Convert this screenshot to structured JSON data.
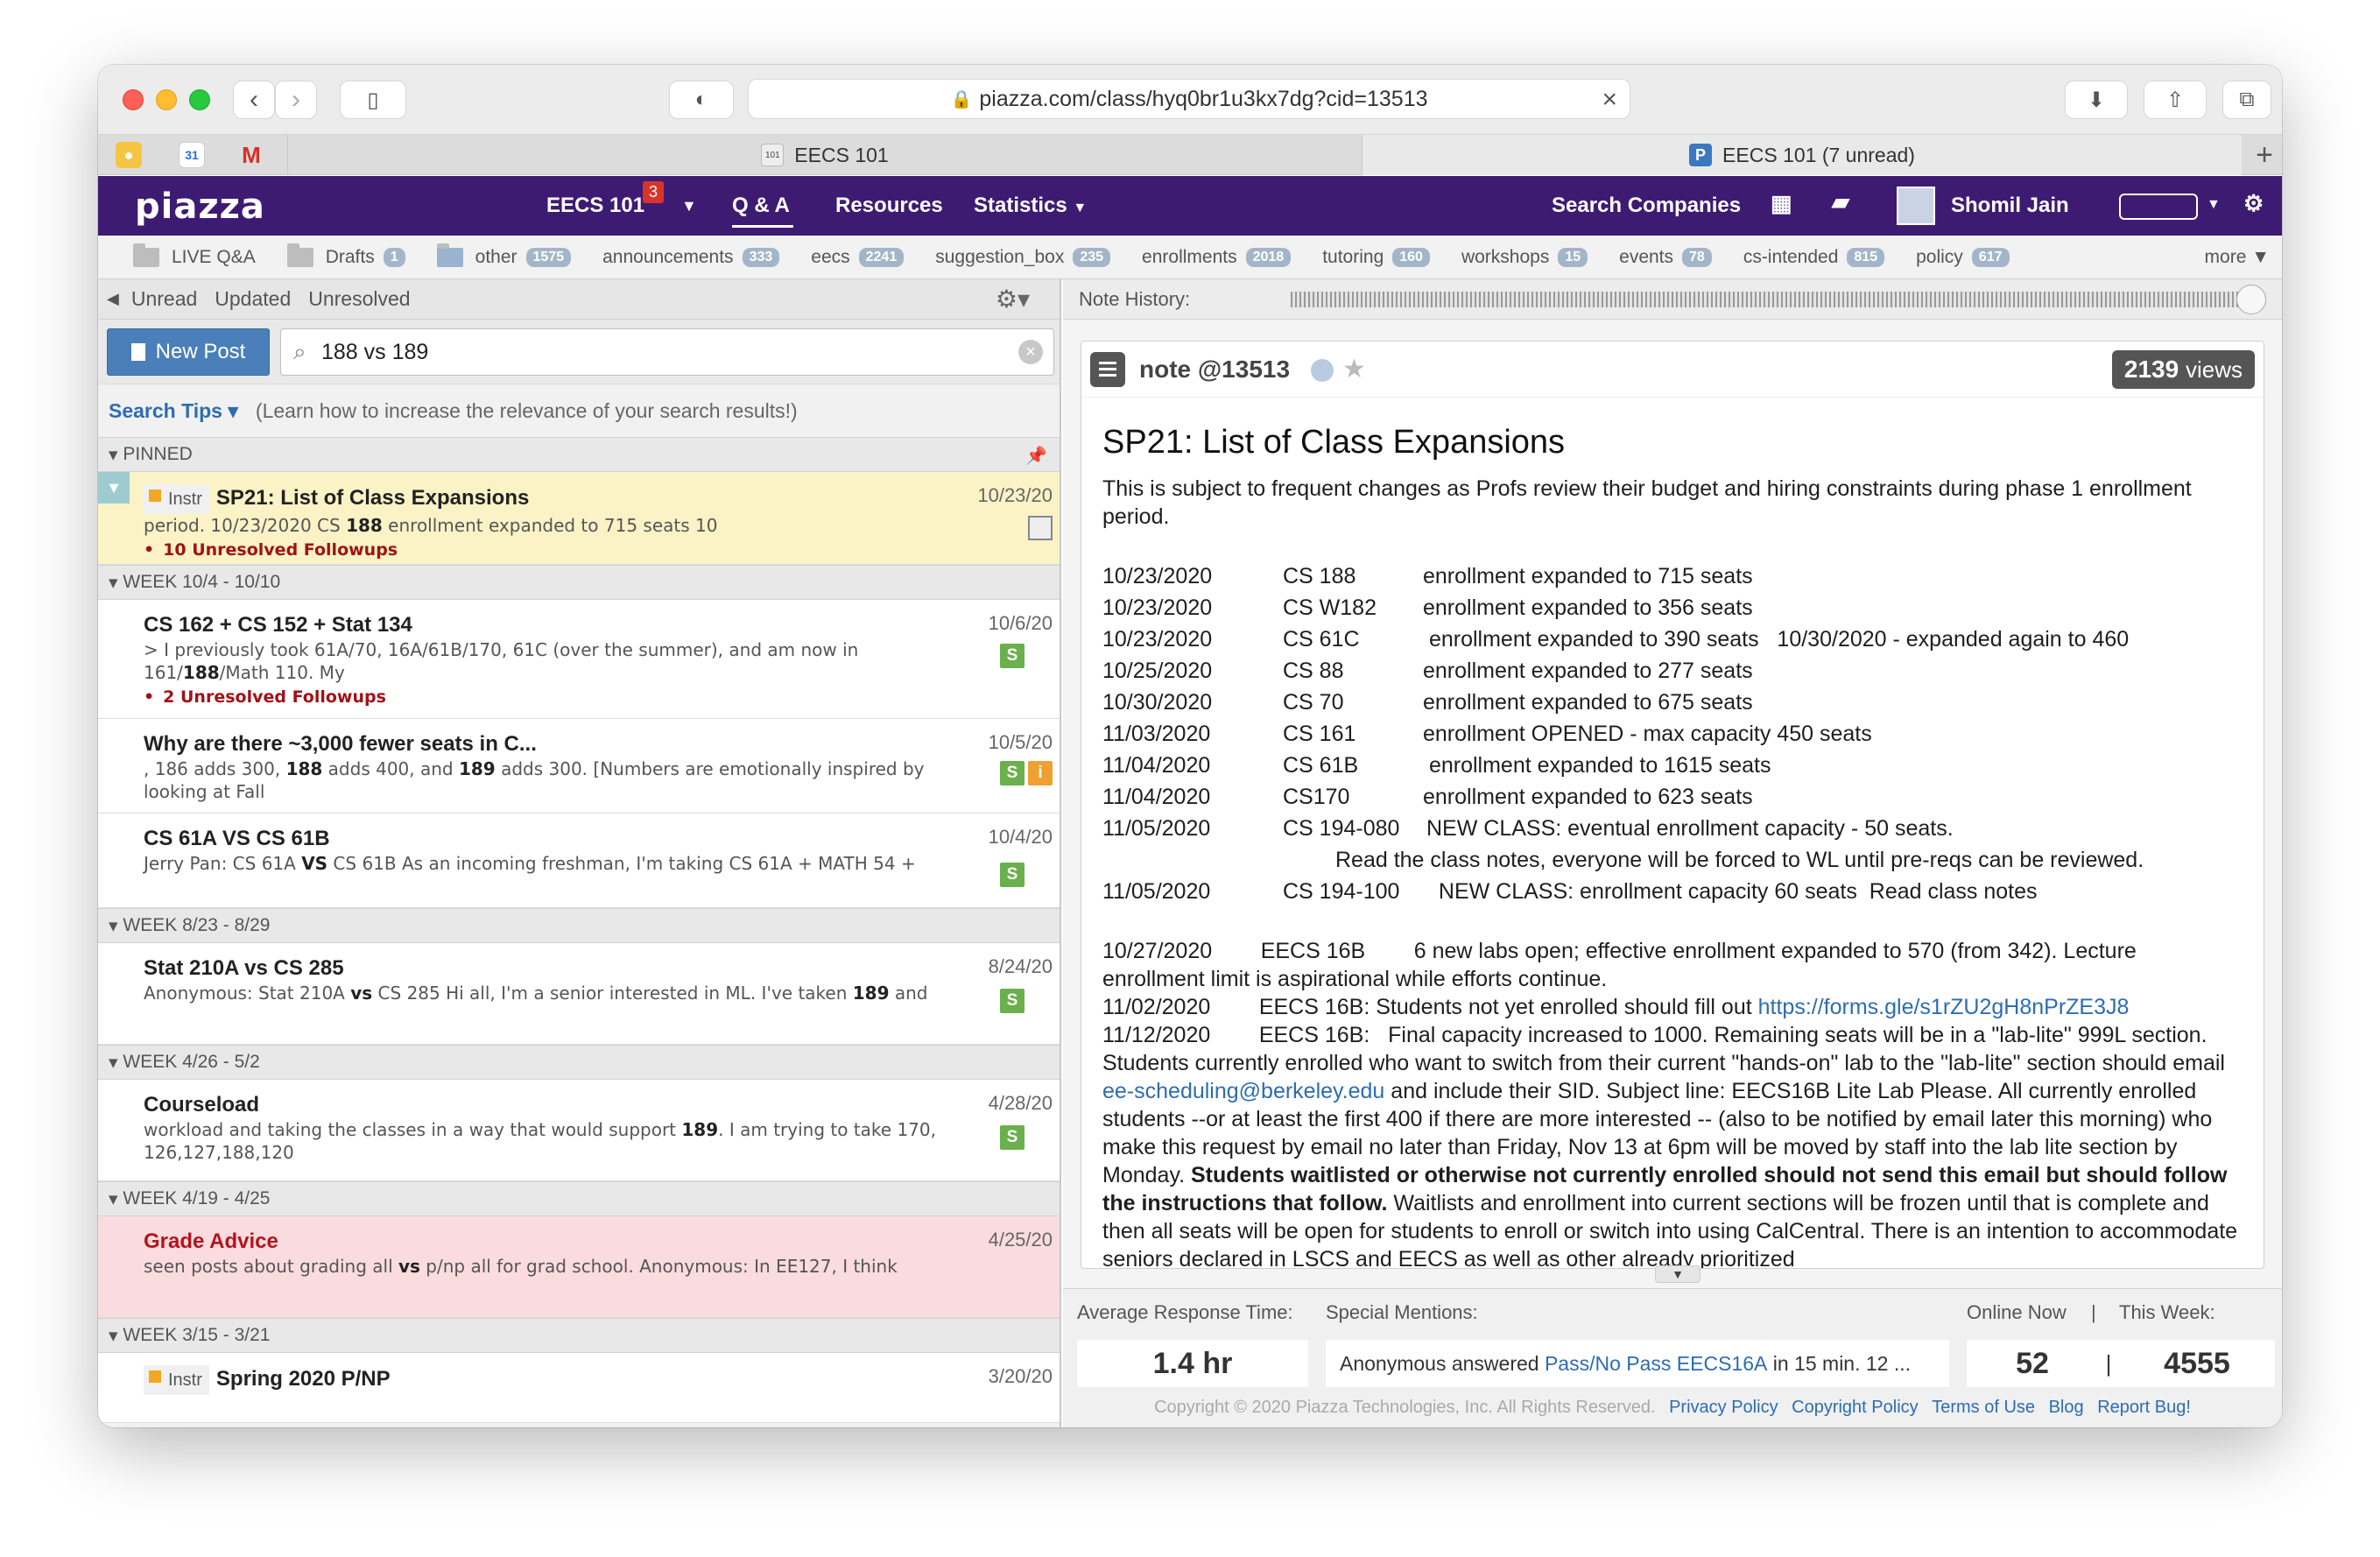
{
  "browser": {
    "url": "piazza.com/class/hyq0br1u3kx7dg?cid=13513",
    "tabs": [
      {
        "label": "EECS 101"
      },
      {
        "label": "EECS 101 (7 unread)"
      }
    ]
  },
  "nav": {
    "logo": "piazza",
    "course": "EECS 101",
    "course_badge": "3",
    "qa": "Q & A",
    "resources": "Resources",
    "statistics": "Statistics",
    "search_companies": "Search Companies",
    "user": "Shomil Jain"
  },
  "folders": [
    {
      "name": "LIVE Q&A",
      "count": ""
    },
    {
      "name": "Drafts",
      "count": "1"
    },
    {
      "name": "other",
      "count": "1575"
    },
    {
      "name": "announcements",
      "count": "333"
    },
    {
      "name": "eecs",
      "count": "2241"
    },
    {
      "name": "suggestion_box",
      "count": "235"
    },
    {
      "name": "enrollments",
      "count": "2018"
    },
    {
      "name": "tutoring",
      "count": "160"
    },
    {
      "name": "workshops",
      "count": "15"
    },
    {
      "name": "events",
      "count": "78"
    },
    {
      "name": "cs-intended",
      "count": "815"
    },
    {
      "name": "policy",
      "count": "617"
    }
  ],
  "folders_more": "more ▼",
  "filters": {
    "unread": "Unread",
    "updated": "Updated",
    "unresolved": "Unresolved"
  },
  "new_post": "New Post",
  "search": {
    "value": "188 vs 189"
  },
  "tips": {
    "link": "Search Tips",
    "note": "(Learn how to increase the relevance of your search results!)"
  },
  "groups": {
    "pinned": "PINNED",
    "w1": "WEEK 10/4 - 10/10",
    "w2": "WEEK 8/23 - 8/29",
    "w3": "WEEK 4/26 - 5/2",
    "w4": "WEEK 4/19 - 4/25",
    "w5": "WEEK 3/15 - 3/21"
  },
  "posts": {
    "p0": {
      "instr": "Instr",
      "title": "SP21: List of Class Expansions",
      "date": "10/23/20",
      "snip_a": "period. 10/23/2020         CS ",
      "snip_b": "188",
      "snip_c": "         enrollment expanded to 715 seats 10",
      "unres": "10 Unresolved Followups"
    },
    "p1": {
      "title": "CS 162 + CS 152 + Stat 134",
      "date": "10/6/20",
      "snip_a": "> I previously took 61A/70, 16A/61B/170, 61C (over the summer), and am now in 161/",
      "snip_b": "188",
      "snip_c": "/Math 110. My",
      "unres": "2 Unresolved Followups"
    },
    "p2": {
      "title": "Why are there ~3,000 fewer seats in C...",
      "date": "10/5/20",
      "snip_a": ", 186 adds 300, ",
      "snip_b": "188",
      "snip_c": " adds 400, and ",
      "snip_d": "189",
      "snip_e": " adds 300. [Numbers are emotionally inspired by looking at Fall"
    },
    "p3": {
      "title": "CS 61A VS CS 61B",
      "date": "10/4/20",
      "snip_a": "Jerry Pan: CS 61A ",
      "snip_b": "VS",
      "snip_c": " CS 61B As an incoming freshman, I'm taking CS 61A + MATH 54 +"
    },
    "p4": {
      "title": "Stat 210A vs CS 285",
      "date": "8/24/20",
      "snip_a": "Anonymous: Stat 210A ",
      "snip_b": "vs",
      "snip_c": " CS 285 Hi all, I'm a senior interested in ML. I've taken ",
      "snip_d": "189",
      "snip_e": " and"
    },
    "p5": {
      "title": "Courseload",
      "date": "4/28/20",
      "snip_a": "workload and taking the classes in a way that would support ",
      "snip_b": "189",
      "snip_c": ". I am trying to take 170, 126,127,188,120"
    },
    "p6": {
      "title": "Grade Advice",
      "date": "4/25/20",
      "snip_a": "seen posts about grading all ",
      "snip_b": "vs",
      "snip_c": " p/np all for grad school. Anonymous: In EE127, I think"
    },
    "p7": {
      "instr": "Instr",
      "title": "Spring 2020 P/NP",
      "date": "3/20/20"
    }
  },
  "badges": {
    "s": "S",
    "i": "i"
  },
  "history_label": "Note History:",
  "note": {
    "label": "note @13513",
    "views_num": "2139",
    "views_word": "views",
    "title": "SP21: List of Class Expansions",
    "intro": "This is subject to frequent changes as Profs review their budget and hiring constraints during phase 1 enrollment period.",
    "rows": [
      {
        "d": "10/23/2020",
        "c": "CS 188",
        "t": "enrollment expanded to 715 seats"
      },
      {
        "d": "10/23/2020",
        "c": "CS W182",
        "t": "enrollment expanded to 356 seats"
      },
      {
        "d": "10/23/2020",
        "c": "CS 61C",
        "t": " enrollment expanded to 390 seats   10/30/2020 - expanded again to 460"
      },
      {
        "d": "10/25/2020",
        "c": "CS 88",
        "t": "enrollment expanded to 277 seats"
      },
      {
        "d": "10/30/2020",
        "c": "CS 70",
        "t": "enrollment expanded to 675 seats"
      },
      {
        "d": "11/03/2020",
        "c": "CS 161",
        "t": "enrollment OPENED - max capacity 450 seats"
      },
      {
        "d": "11/04/2020",
        "c": "CS 61B",
        "t": " enrollment expanded to 1615 seats"
      },
      {
        "d": "11/04/2020",
        "c": "CS170",
        "t": "enrollment expanded to 623 seats"
      },
      {
        "d": "11/05/2020",
        "c": "CS 194-080",
        "t": "NEW CLASS: eventual enrollment capacity - 50 seats."
      }
    ],
    "row_cont": "Read the class notes, everyone will be forced to WL until pre-reqs can be reviewed.",
    "row_last": {
      "d": "11/05/2020",
      "c": "CS 194-100",
      "t": "  NEW CLASS: enrollment capacity 60 seats  Read class notes"
    },
    "p_16b_1": "10/27/2020        EECS 16B        6 new labs open; effective enrollment expanded to 570 (from 342). Lecture enrollment limit is aspirational while efforts continue.",
    "p_16b_2_pre": "11/02/2020        EECS 16B: Students not yet enrolled should fill out ",
    "p_16b_2_link": "https://forms.gle/s1rZU2gH8nPrZE3J8",
    "p_16b_3_a": "11/12/2020        EECS 16B:   Final capacity increased to 1000. Remaining seats will be in a \"lab-lite\" 999L section.  Students currently enrolled who want to switch from their current \"hands-on\" lab to the \"lab-lite\" section should email ",
    "p_16b_3_email": "ee-scheduling@berkeley.edu",
    "p_16b_3_b": " and include their SID. Subject line: EECS16B Lite Lab Please. All currently enrolled students --or at least the first 400 if there are more interested -- (also to be notified by email later this morning) who make this request by email no later than Friday, Nov 13 at 6pm will be moved by staff into the lab lite section by Monday. ",
    "p_16b_3_bold": "Students waitlisted or otherwise not currently enrolled should not send this email but should follow the instructions that follow.",
    "p_16b_3_c": " Waitlists and enrollment into current sections will be frozen until that is complete and then all seats will be open for students to enroll or switch into using CalCentral. There is an intention to accommodate seniors declared in LSCS and EECS as well as other already prioritized"
  },
  "stats": {
    "avg_label": "Average Response Time:",
    "avg_value": "1.4 hr",
    "mentions_label": "Special Mentions:",
    "mention_pre": "Anonymous answered ",
    "mention_link": "Pass/No Pass EECS16A",
    "mention_post": " in 15 min. 12 ...",
    "online_label": "Online Now",
    "sep": "|",
    "week_label": "This Week:",
    "online_value": "52",
    "week_value": "4555"
  },
  "footer": {
    "copyright": "Copyright © 2020 Piazza Technologies, Inc. All Rights Reserved.",
    "links": [
      "Privacy Policy",
      "Copyright Policy",
      "Terms of Use",
      "Blog",
      "Report Bug!"
    ]
  }
}
